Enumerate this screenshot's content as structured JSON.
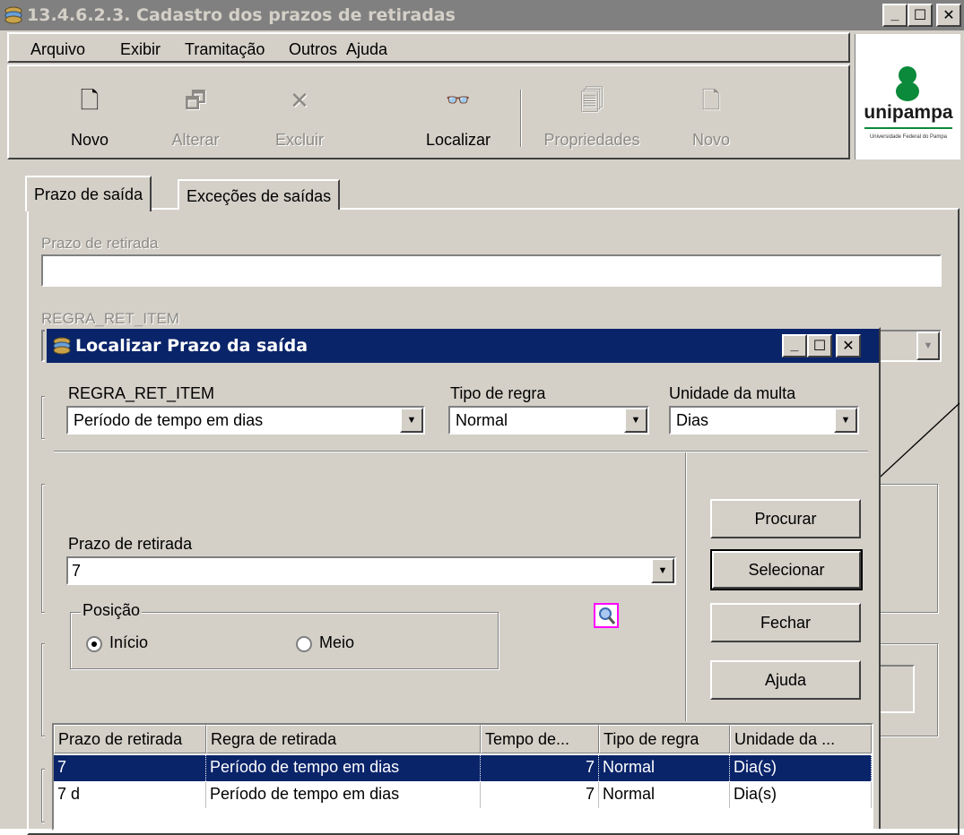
{
  "main_window": {
    "title": "13.4.6.2.3. Cadastro dos prazos de retiradas",
    "menu": [
      "Arquivo",
      "Exibir",
      "Tramitação",
      "Outros",
      "Ajuda"
    ],
    "toolbar": {
      "novo": "Novo",
      "alterar": "Alterar",
      "excluir": "Excluir",
      "localizar": "Localizar",
      "propriedades": "Propriedades",
      "novo2": "Novo"
    },
    "logo": {
      "name": "unipampa",
      "tagline": "Universidade Federal do Pampa"
    },
    "tabs": [
      "Prazo de saída",
      "Exceções de saídas"
    ],
    "form": {
      "prazo_label": "Prazo de retirada",
      "prazo_value": "",
      "regra_label": "REGRA_RET_ITEM"
    }
  },
  "dialog": {
    "title": "Localizar Prazo da saída",
    "regra_label": "REGRA_RET_ITEM",
    "regra_value": "Período de tempo em dias",
    "tipo_label": "Tipo de regra",
    "tipo_value": "Normal",
    "unidade_label": "Unidade da multa",
    "unidade_value": "Dias",
    "prazo_label": "Prazo de retirada",
    "prazo_value": "7",
    "posicao_label": "Posição",
    "radio_inicio": "Início",
    "radio_meio": "Meio",
    "buttons": {
      "procurar": "Procurar",
      "selecionar": "Selecionar",
      "fechar": "Fechar",
      "ajuda": "Ajuda"
    },
    "grid": {
      "columns": [
        "Prazo de retirada",
        "Regra de retirada",
        "Tempo de...",
        "Tipo de regra",
        "Unidade da ..."
      ],
      "rows": [
        [
          "7",
          "Período de tempo em dias",
          "7",
          "Normal",
          "Dia(s)"
        ],
        [
          "7 d",
          "Período de tempo em dias",
          "7",
          "Normal",
          "Dia(s)"
        ]
      ]
    }
  },
  "colors": {
    "inactive_title": "#808080",
    "active_title": "#0a246a",
    "face": "#d4d0c8",
    "logo_green": "#0a8a3a"
  }
}
